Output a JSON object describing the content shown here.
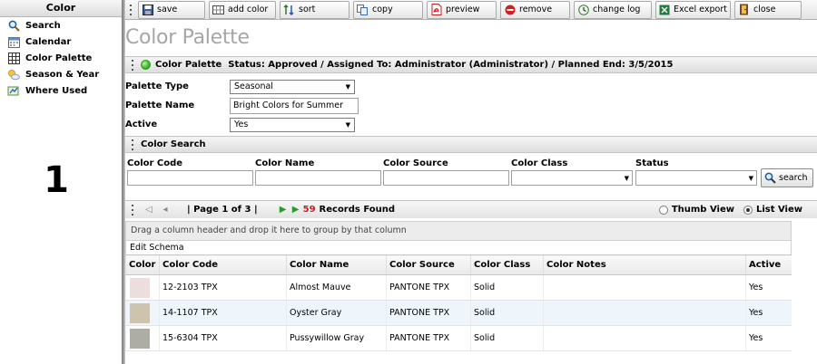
{
  "sidebar": {
    "header": "Color",
    "items": [
      {
        "label": "Search",
        "icon": "magnifier-icon"
      },
      {
        "label": "Calendar",
        "icon": "calendar-icon"
      },
      {
        "label": "Color Palette",
        "icon": "palette-grid-icon"
      },
      {
        "label": "Season & Year",
        "icon": "season-icon"
      },
      {
        "label": "Where Used",
        "icon": "where-used-icon"
      }
    ],
    "big_number": "1"
  },
  "toolbar": {
    "save": "save",
    "add_color": "add color",
    "sort": "sort",
    "copy": "copy",
    "preview": "preview",
    "remove": "remove",
    "change_log": "change log",
    "excel_export": "Excel export",
    "close": "close"
  },
  "page_title": "Color Palette",
  "status_bar": {
    "text": "Color Palette  Status: Approved / Assigned To: Administrator (Administrator) / Planned End: 3/5/2015",
    "status_color": "#2fa51f"
  },
  "form": {
    "palette_type_label": "Palette Type",
    "palette_type_value": "Seasonal",
    "palette_name_label": "Palette Name",
    "palette_name_value": "Bright Colors for Summer",
    "active_label": "Active",
    "active_value": "Yes"
  },
  "color_search": {
    "title": "Color Search",
    "color_code_label": "Color Code",
    "color_name_label": "Color Name",
    "color_source_label": "Color Source",
    "color_class_label": "Color Class",
    "status_label": "Status",
    "search_button": "search"
  },
  "pager": {
    "page_text": "| Page 1 of 3 |",
    "records_count": "59",
    "records_text": "Records Found",
    "thumb_view": "Thumb View",
    "list_view": "List View",
    "selected_view": "list"
  },
  "grid": {
    "group_hint": "Drag a column header and drop it here to group by that column",
    "edit_schema": "Edit Schema",
    "columns": [
      "Color",
      "Color Code",
      "Color Name",
      "Color Source",
      "Color Class",
      "Color Notes",
      "Active"
    ],
    "rows": [
      {
        "swatch": "#eddedd",
        "code": "12-2103 TPX",
        "name": "Almost Mauve",
        "source": "PANTONE TPX",
        "class": "Solid",
        "notes": "",
        "active": "Yes"
      },
      {
        "swatch": "#cdc3ae",
        "code": "14-1107 TPX",
        "name": "Oyster Gray",
        "source": "PANTONE TPX",
        "class": "Solid",
        "notes": "",
        "active": "Yes"
      },
      {
        "swatch": "#aeada4",
        "code": "15-6304 TPX",
        "name": "Pussywillow Gray",
        "source": "PANTONE TPX",
        "class": "Solid",
        "notes": "",
        "active": "Yes"
      }
    ]
  }
}
